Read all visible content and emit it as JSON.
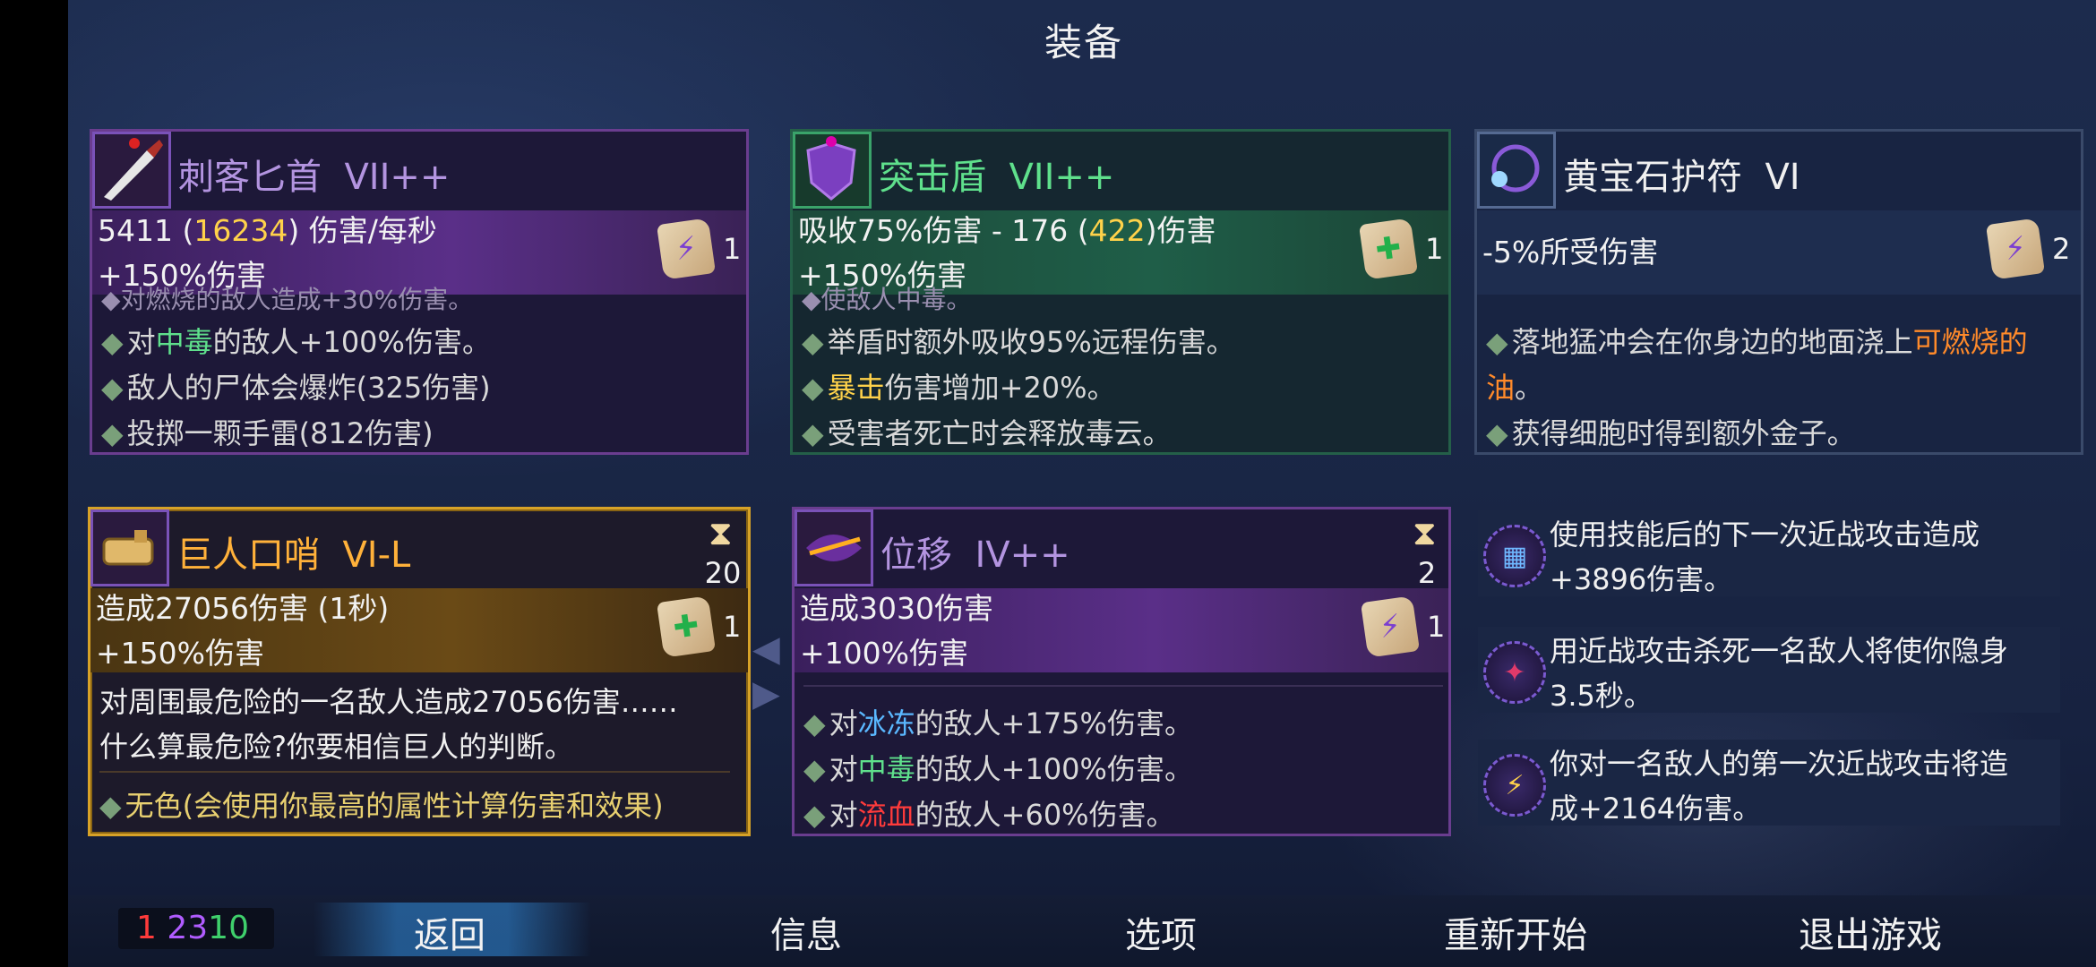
{
  "title": "装备",
  "colors": {
    "brutality": "#ff3b3b",
    "tactics": "#b05cff",
    "survival": "#3fd06c",
    "highlight_yellow": "#ffd24a",
    "gold_border": "#d7a227"
  },
  "weapon1": {
    "name": "刺客匕首",
    "tier": "VII++",
    "icon": "dagger-icon",
    "stat_a": "5411 (",
    "stat_b": "16234",
    "stat_c": ") 伤害/每秒",
    "bonus": "+150%伤害",
    "scroll_count": "1",
    "cut_line": "◆对燃烧的敌人造成+30%伤害。",
    "effects": [
      {
        "pre": "对",
        "hl": "中毒",
        "post": "的敌人+100%伤害。"
      },
      {
        "pre": "敌人的尸体会爆炸(325伤害)",
        "hl": "",
        "post": ""
      },
      {
        "pre": "投掷一颗手雷(812伤害)",
        "hl": "",
        "post": ""
      }
    ]
  },
  "weapon2": {
    "name": "突击盾",
    "tier": "VII++",
    "icon": "shield-icon",
    "stat_a": "吸收75%伤害 - 176 (",
    "stat_b": "422",
    "stat_c": ")伤害",
    "bonus": "+150%伤害",
    "scroll_count": "1",
    "cut_line": "◆使敌人中毒。",
    "effects": [
      {
        "pre": "举盾时额外吸收95%远程伤害。",
        "hl": "",
        "post": ""
      },
      {
        "pre": "",
        "hl": "暴击",
        "post": "伤害增加+20%。"
      },
      {
        "pre": "受害者死亡时会释放毒云。",
        "hl": "",
        "post": ""
      }
    ]
  },
  "amulet": {
    "name": "黄宝石护符",
    "tier": "VI",
    "icon": "amulet-icon",
    "stat": "-5%所受伤害",
    "scroll_count": "2",
    "effect1_pre": "落地猛冲会在你身边的地面浇上",
    "effect1_hl1": "可燃烧的",
    "effect1_hl2": "油",
    "effect1_post": "。",
    "effect2": "获得细胞时得到额外金子。"
  },
  "skill1": {
    "name": "巨人口哨",
    "tier": "VI-L",
    "icon": "whistle-icon",
    "cooldown": "20",
    "stat": "造成27056伤害 (1秒)",
    "bonus": "+150%伤害",
    "scroll_count": "1",
    "desc1": "对周围最危险的一名敌人造成27056伤害……",
    "desc2": "什么算最危险?你要相信巨人的判断。",
    "note": "无色(会使用你最高的属性计算伤害和效果)"
  },
  "skill2": {
    "name": "位移",
    "tier": "IV++",
    "icon": "phase-icon",
    "cooldown": "2",
    "stat": "造成3030伤害",
    "bonus": "+100%伤害",
    "scroll_count": "1",
    "effects": [
      {
        "pre": "对",
        "hl": "冰冻",
        "post": "的敌人+175%伤害。",
        "color": "blue"
      },
      {
        "pre": "对",
        "hl": "中毒",
        "post": "的敌人+100%伤害。",
        "color": "green"
      },
      {
        "pre": "对",
        "hl": "流血",
        "post": "的敌人+60%伤害。",
        "color": "red"
      }
    ]
  },
  "perks": [
    {
      "icon": "rune-scroll-icon",
      "line1": "使用技能后的下一次近战攻击造成",
      "line2": "+3896伤害。"
    },
    {
      "icon": "assassin-perk-icon",
      "line1": "用近战攻击杀死一名敌人将使你隐身",
      "line2": "3.5秒。"
    },
    {
      "icon": "lightning-perk-icon",
      "line1": "你对一名敌人的第一次近战攻击将造",
      "line2": "成+2164伤害。"
    }
  ],
  "stats": {
    "brutality": "1",
    "tactics": "23",
    "survival": "10"
  },
  "menu": {
    "back": "返回",
    "info": "信息",
    "options": "选项",
    "restart": "重新开始",
    "quit": "退出游戏"
  }
}
